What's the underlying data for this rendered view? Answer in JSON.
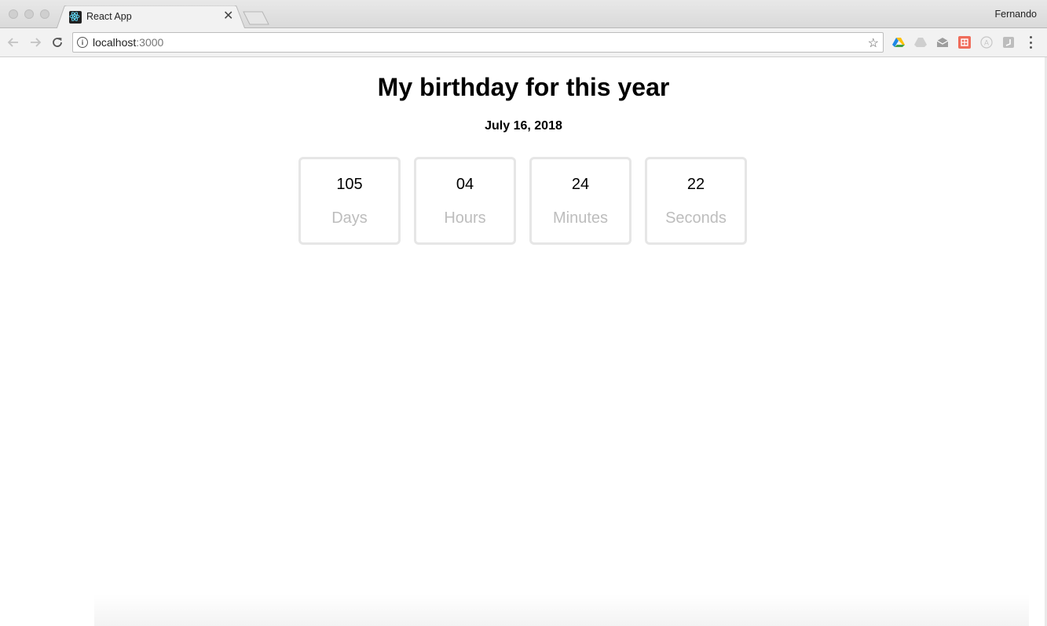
{
  "browser": {
    "tab_title": "React App",
    "profile_name": "Fernando",
    "url_host": "localhost",
    "url_port": ":3000"
  },
  "page": {
    "title": "My birthday for this year",
    "date": "July 16, 2018"
  },
  "countdown": [
    {
      "value": "105",
      "label": "Days"
    },
    {
      "value": "04",
      "label": "Hours"
    },
    {
      "value": "24",
      "label": "Minutes"
    },
    {
      "value": "22",
      "label": "Seconds"
    }
  ],
  "icons": {
    "favicon": "react-logo-icon",
    "extensions": [
      "google-drive-icon",
      "cloud-icon",
      "mail-icon",
      "red-extension-icon",
      "circle-a-icon",
      "square-extension-icon"
    ]
  }
}
